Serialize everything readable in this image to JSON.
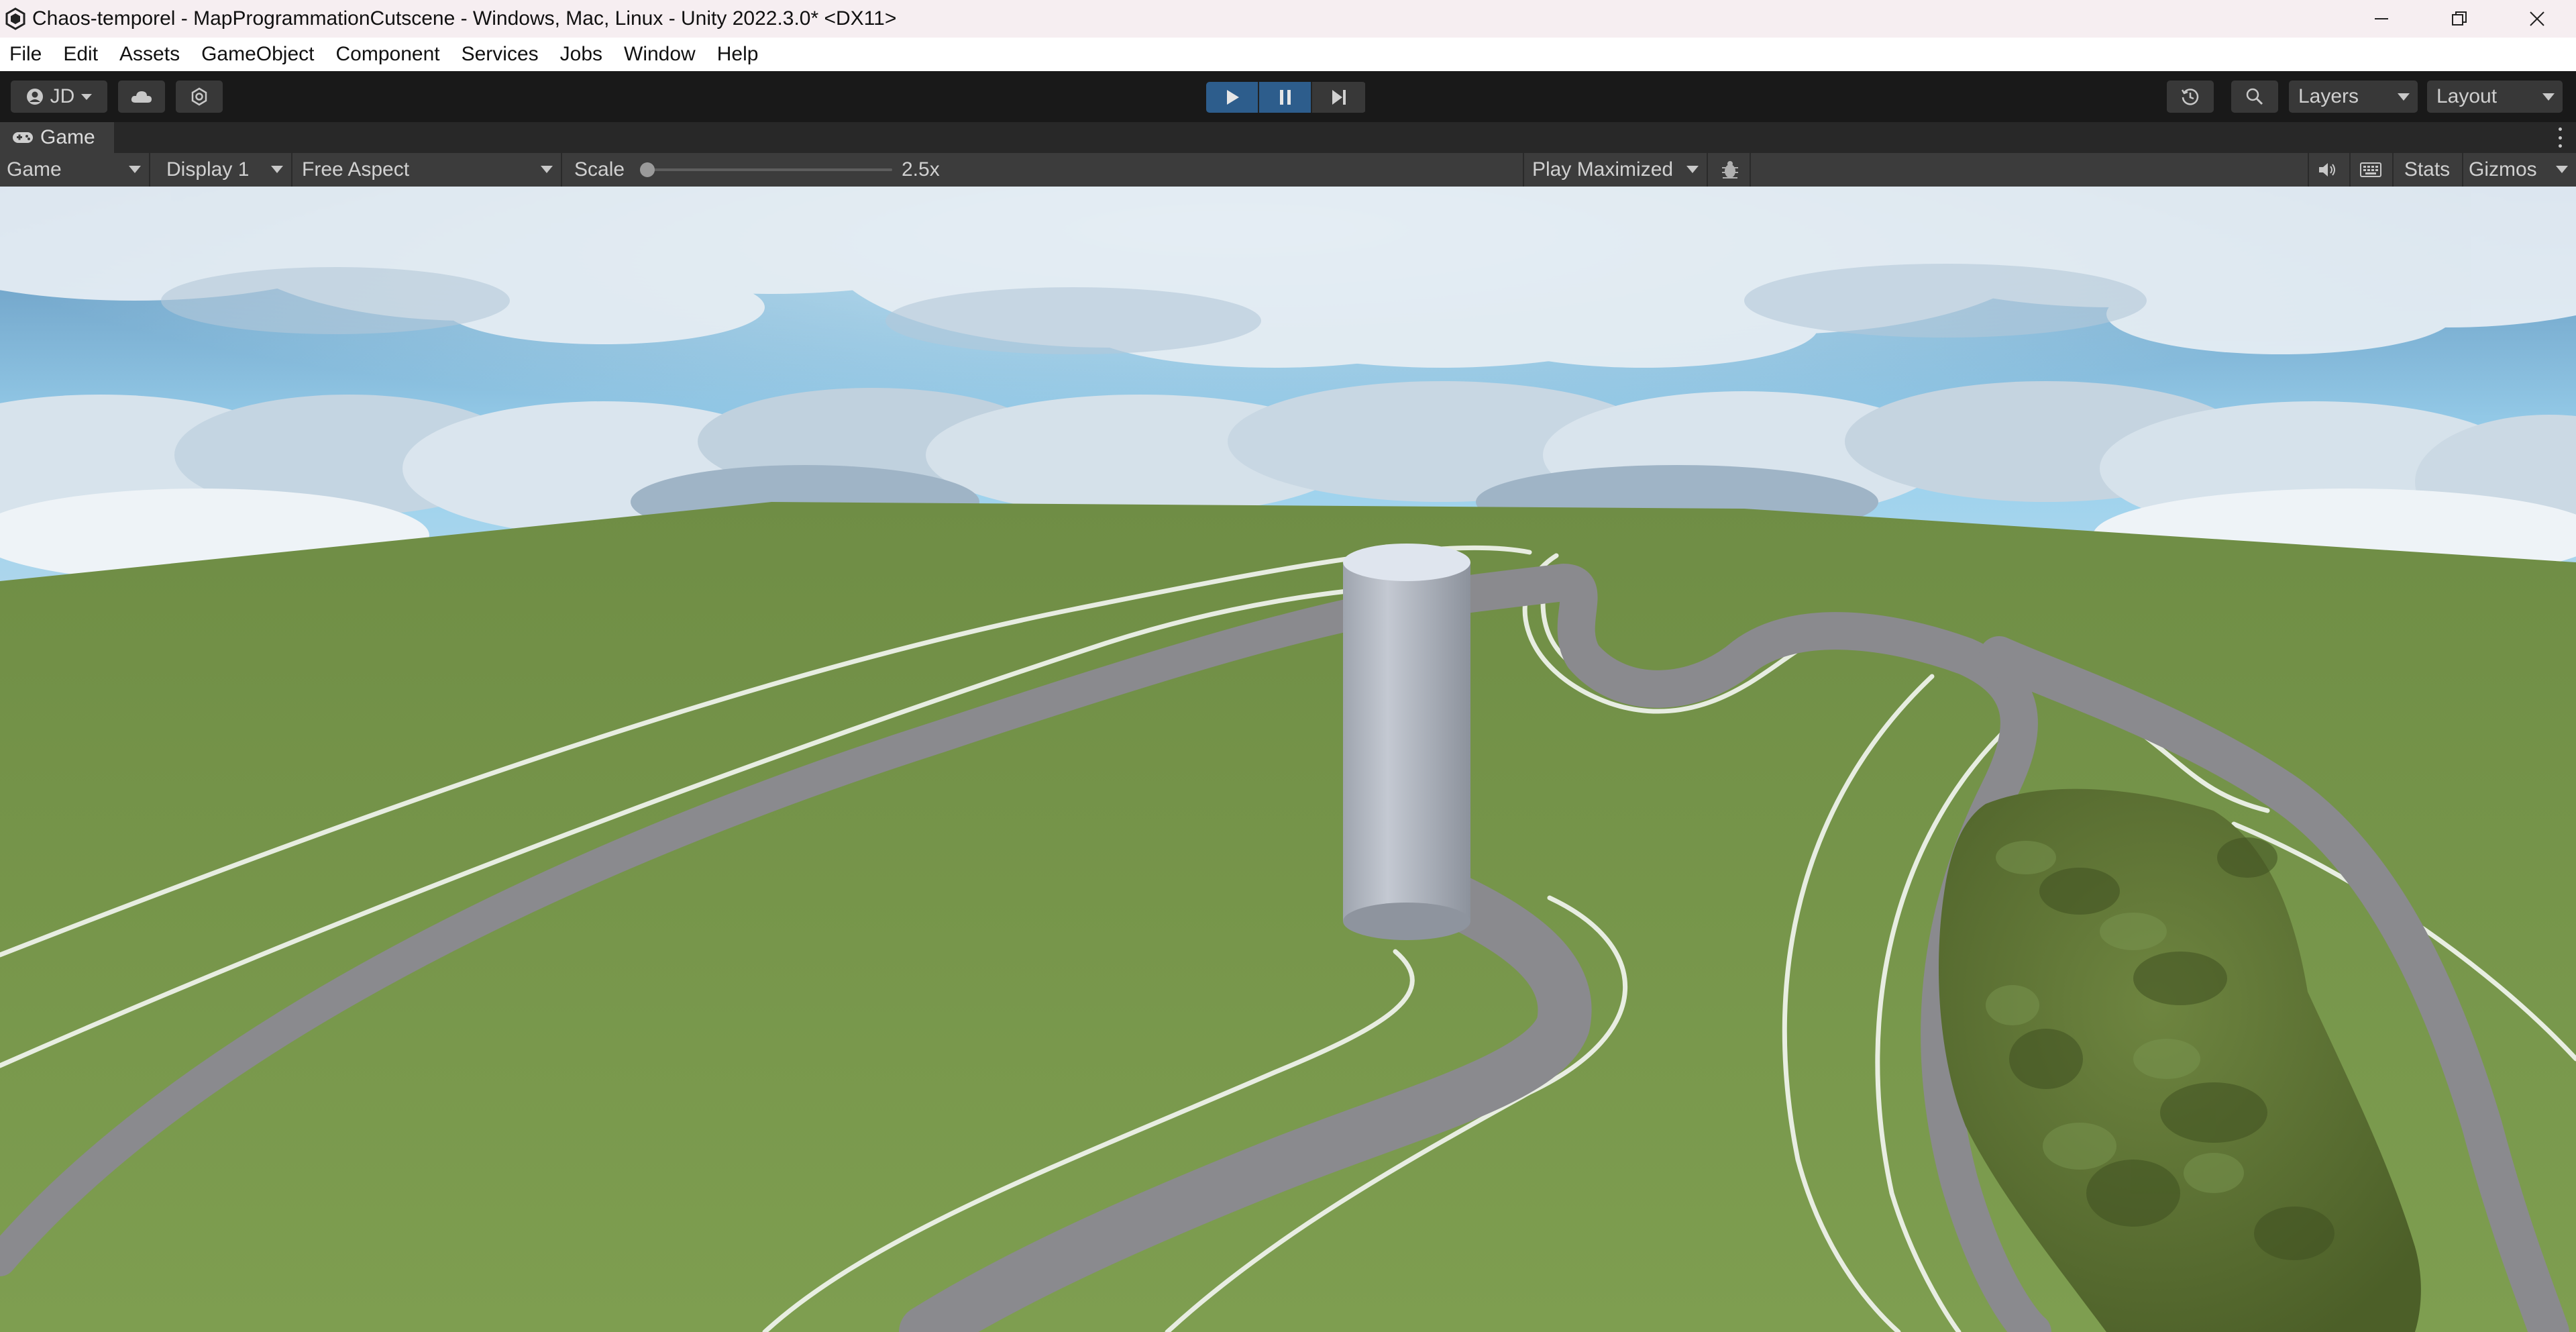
{
  "window": {
    "title": "Chaos-temporel - MapProgrammationCutscene - Windows, Mac, Linux - Unity 2022.3.0* <DX11>"
  },
  "menu": {
    "items": [
      "File",
      "Edit",
      "Assets",
      "GameObject",
      "Component",
      "Services",
      "Jobs",
      "Window",
      "Help"
    ]
  },
  "toolbar": {
    "account_label": "JD",
    "layers_label": "Layers",
    "layout_label": "Layout",
    "play_state": "playing",
    "accent_color": "#2d5d8c"
  },
  "game_tab": {
    "label": "Game"
  },
  "game_toolbar": {
    "view_select": "Game",
    "display_select": "Display 1",
    "aspect_select": "Free Aspect",
    "scale_label": "Scale",
    "scale_value": "2.5x",
    "play_mode_select": "Play Maximized",
    "stats_label": "Stats",
    "gizmos_label": "Gizmos"
  },
  "scene": {
    "sky_color": "#8fc7e6",
    "cloud_color": "#e9f1f7",
    "grass_color": "#7c9a4e",
    "track_color": "#8a8a8e",
    "pillar_color": "#b6bcc6",
    "hill_color": "#5b7031"
  }
}
